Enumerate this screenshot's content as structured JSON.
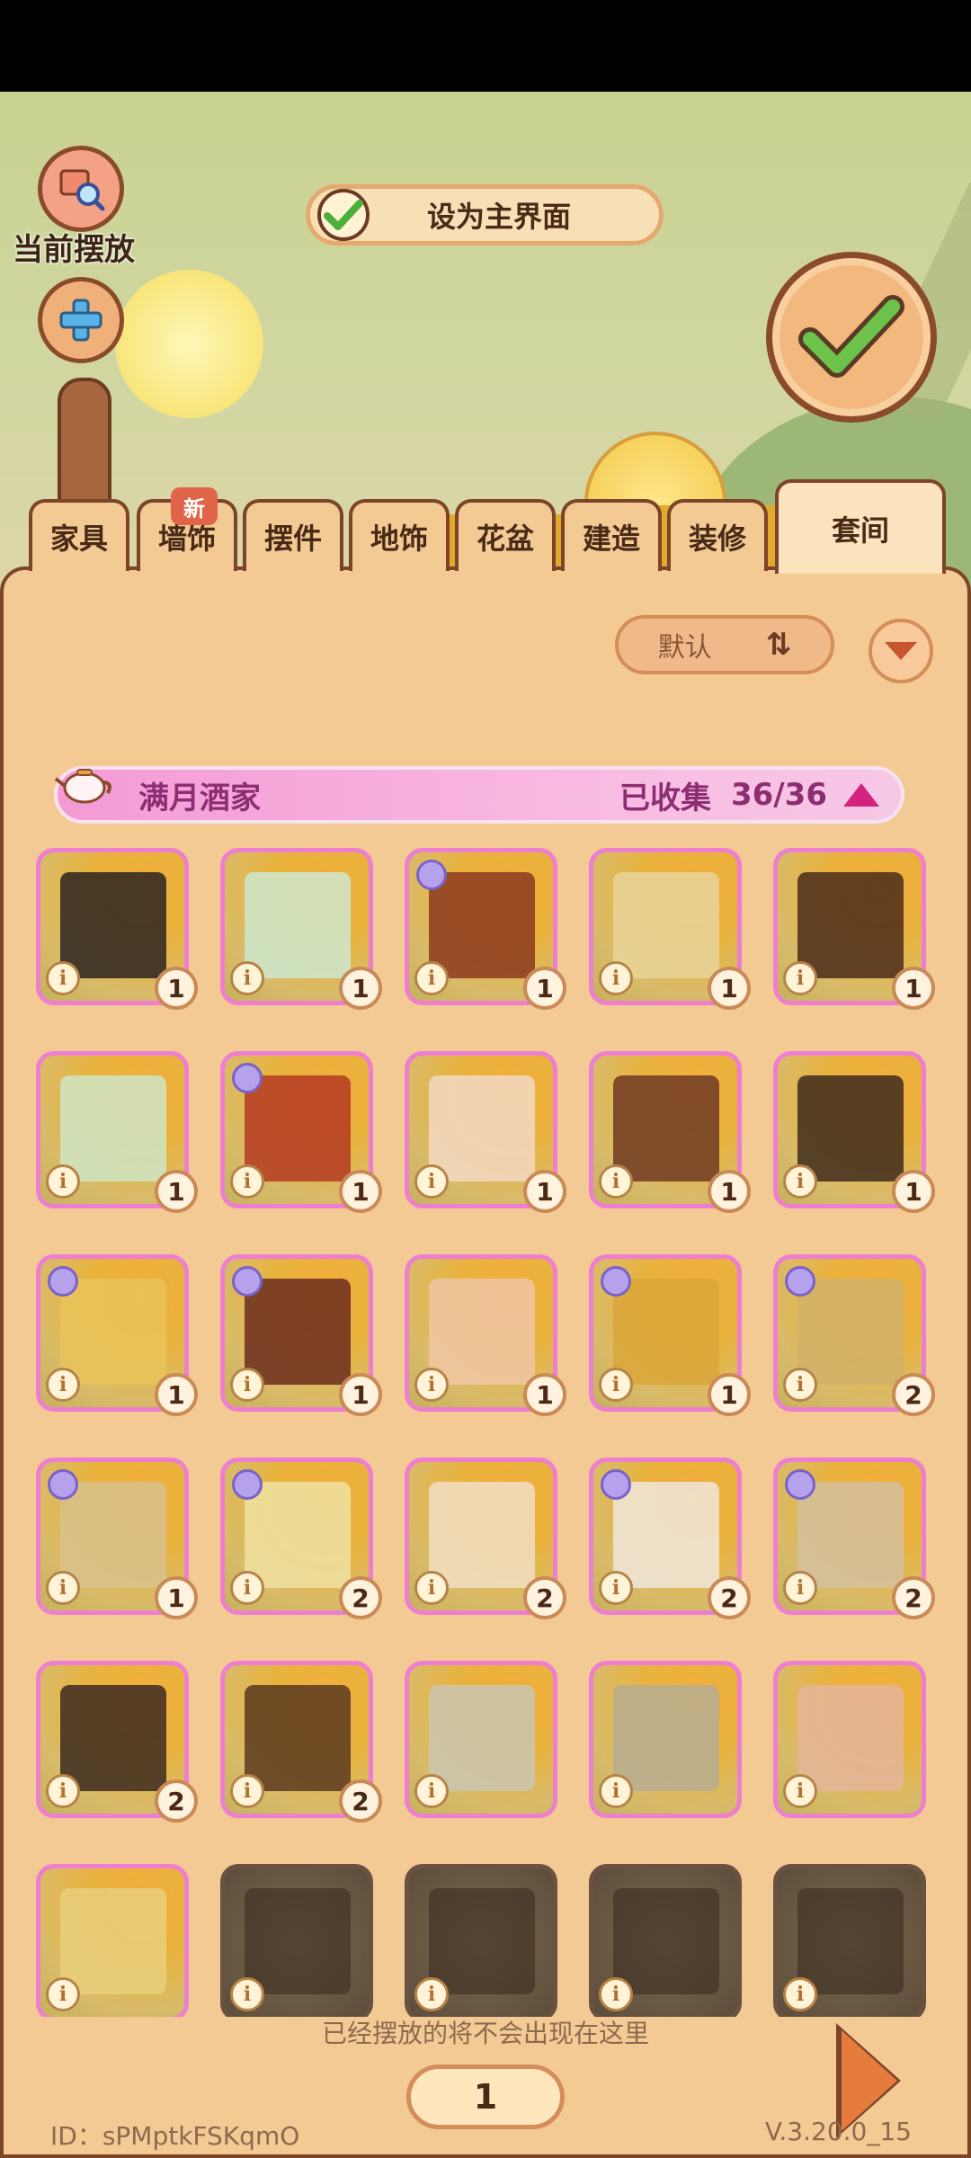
{
  "header": {
    "placed_label": "当前摆放",
    "set_home_label": "设为主界面"
  },
  "tabs": [
    {
      "label": "家具"
    },
    {
      "label": "墙饰",
      "badge": "新"
    },
    {
      "label": "摆件"
    },
    {
      "label": "地饰"
    },
    {
      "label": "花盆"
    },
    {
      "label": "建造"
    },
    {
      "label": "装修"
    },
    {
      "label": "套间",
      "active": true
    }
  ],
  "sort": {
    "label": "默认"
  },
  "set": {
    "name": "满月酒家",
    "collected_label": "已收集",
    "collected_count": "36/36"
  },
  "items": [
    {
      "qty": "1",
      "locked": false,
      "suit": false,
      "color": "#2a2320"
    },
    {
      "qty": "1",
      "locked": false,
      "suit": false,
      "color": "#cde8cf"
    },
    {
      "qty": "1",
      "locked": false,
      "suit": true,
      "color": "#8b3a1f"
    },
    {
      "qty": "1",
      "locked": false,
      "suit": false,
      "color": "#e7d39a"
    },
    {
      "qty": "1",
      "locked": false,
      "suit": false,
      "color": "#4a2a1a"
    },
    {
      "qty": "1",
      "locked": false,
      "suit": false,
      "color": "#cfe5c4"
    },
    {
      "qty": "1",
      "locked": false,
      "suit": true,
      "color": "#b33a22"
    },
    {
      "qty": "1",
      "locked": false,
      "suit": false,
      "color": "#f2d9c3"
    },
    {
      "qty": "1",
      "locked": false,
      "suit": false,
      "color": "#6e3a23"
    },
    {
      "qty": "1",
      "locked": false,
      "suit": false,
      "color": "#3e2a1d"
    },
    {
      "qty": "1",
      "locked": false,
      "suit": true,
      "color": "#e9c35a"
    },
    {
      "qty": "1",
      "locked": false,
      "suit": true,
      "color": "#6b2d1e"
    },
    {
      "qty": "1",
      "locked": false,
      "suit": false,
      "color": "#efc7a5"
    },
    {
      "qty": "1",
      "locked": false,
      "suit": true,
      "color": "#d9a63a"
    },
    {
      "qty": "2",
      "locked": false,
      "suit": true,
      "color": "#d1b16a"
    },
    {
      "qty": "1",
      "locked": false,
      "suit": true,
      "color": "#d8c18d"
    },
    {
      "qty": "2",
      "locked": false,
      "suit": true,
      "color": "#efe2a2"
    },
    {
      "qty": "2",
      "locked": false,
      "suit": false,
      "color": "#f1dfc4"
    },
    {
      "qty": "2",
      "locked": false,
      "suit": true,
      "color": "#f0e6dc"
    },
    {
      "qty": "2",
      "locked": false,
      "suit": true,
      "color": "#d4c0a0"
    },
    {
      "qty": "2",
      "locked": false,
      "suit": false,
      "color": "#3c2a20"
    },
    {
      "qty": "2",
      "locked": false,
      "suit": false,
      "color": "#5a3a20"
    },
    {
      "qty": "",
      "locked": false,
      "suit": false,
      "color": "#c9c5b0"
    },
    {
      "qty": "",
      "locked": false,
      "suit": false,
      "color": "#b6ad92"
    },
    {
      "qty": "",
      "locked": false,
      "suit": false,
      "color": "#e3b59b"
    },
    {
      "qty": "",
      "locked": false,
      "suit": false,
      "color": "#e9cf7c"
    },
    {
      "qty": "",
      "locked": true,
      "suit": false,
      "color": "#3b2c22"
    },
    {
      "qty": "",
      "locked": true,
      "suit": false,
      "color": "#3b2c22"
    },
    {
      "qty": "",
      "locked": true,
      "suit": false,
      "color": "#3b2c22"
    },
    {
      "qty": "",
      "locked": true,
      "suit": false,
      "color": "#3b2c22"
    }
  ],
  "footer": {
    "note": "已经摆放的将不会出现在这里",
    "page": "1",
    "user_id": "ID：sPMptkFSKqmO",
    "version": "V.3.20.0_15"
  },
  "colors": {
    "accent_pink": "#f49ad5",
    "panel": "#f3c994",
    "border_brown": "#7c4529"
  }
}
